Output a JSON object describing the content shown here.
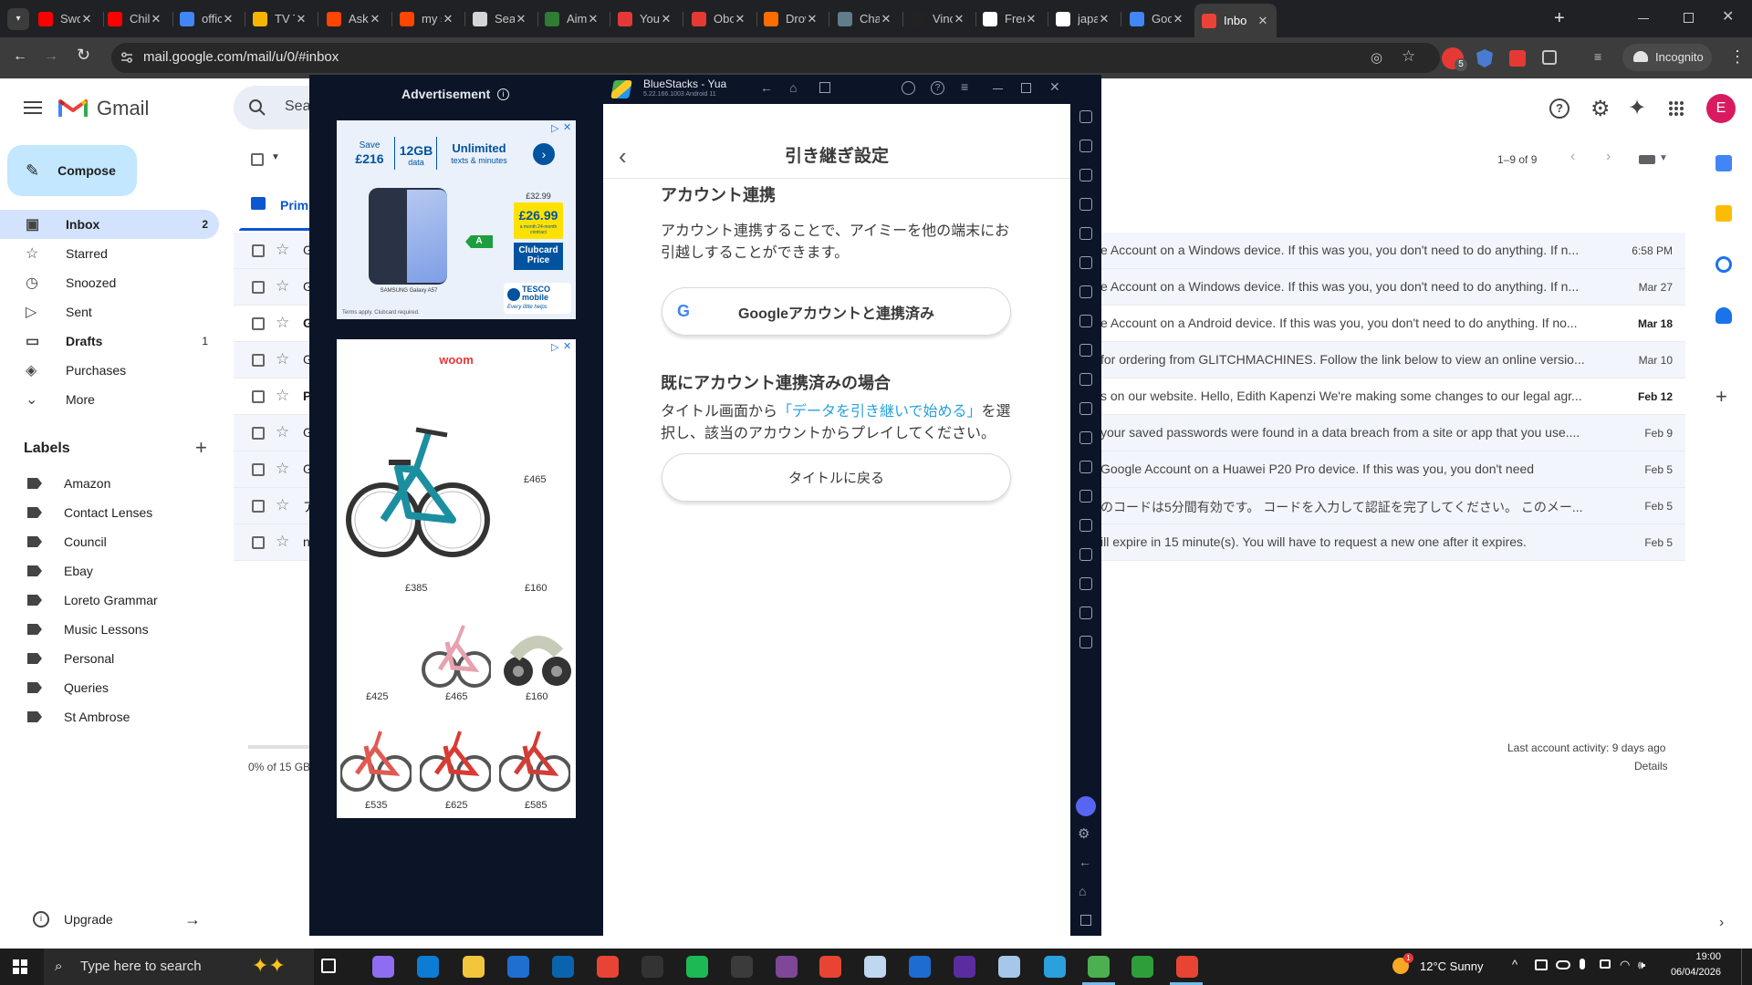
{
  "browser": {
    "tabs": [
      {
        "label": "Swor",
        "color": "#ff0000"
      },
      {
        "label": "Child",
        "color": "#ff0000"
      },
      {
        "label": "offici",
        "color": "#4285f4"
      },
      {
        "label": "TV Tr",
        "color": "#f4b400"
      },
      {
        "label": "AskM",
        "color": "#ff4500"
      },
      {
        "label": "my st",
        "color": "#ff4500"
      },
      {
        "label": "Searc",
        "color": "#d5d5d5"
      },
      {
        "label": "Aimy",
        "color": "#2e7d32"
      },
      {
        "label": "Youk",
        "color": "#e53935"
      },
      {
        "label": "Obor",
        "color": "#e53935"
      },
      {
        "label": "Drow",
        "color": "#ff6d00"
      },
      {
        "label": "Chap",
        "color": "#607d8b"
      },
      {
        "label": "Vinci",
        "color": "#222222"
      },
      {
        "label": "Free",
        "color": "#ffffff"
      },
      {
        "label": "japa",
        "color": "#ffffff"
      },
      {
        "label": "Goo",
        "color": "#4285f4"
      },
      {
        "label": "Inbo",
        "color": "#ea4335"
      }
    ],
    "url": "mail.google.com/mail/u/0/#inbox",
    "incognito_label": "Incognito",
    "extension_badge": "5"
  },
  "gmail": {
    "app_name": "Gmail",
    "search_placeholder": "Sea",
    "compose_label": "Compose",
    "nav": [
      {
        "label": "Inbox",
        "count": "2"
      },
      {
        "label": "Starred",
        "count": ""
      },
      {
        "label": "Snoozed",
        "count": ""
      },
      {
        "label": "Sent",
        "count": ""
      },
      {
        "label": "Drafts",
        "count": "1"
      },
      {
        "label": "Purchases",
        "count": ""
      },
      {
        "label": "More",
        "count": ""
      }
    ],
    "labels_heading": "Labels",
    "labels": [
      "Amazon",
      "Contact Lenses",
      "Council",
      "Ebay",
      "Loreto Grammar",
      "Music Lessons",
      "Personal",
      "Queries",
      "St Ambrose"
    ],
    "upgrade_label": "Upgrade",
    "tab_primary": "Prim",
    "pagination": "1–9 of 9",
    "avatar_letter": "E",
    "storage": "0% of 15 GB",
    "last_activity": "Last account activity: 9 days ago",
    "details": "Details",
    "emails": [
      {
        "sender": "G",
        "snippet": "e Account on a Windows device. If this was you, you don't need to do anything. If n...",
        "date": "6:58 PM",
        "unread": false
      },
      {
        "sender": "G",
        "snippet": "e Account on a Windows device. If this was you, you don't need to do anything. If n...",
        "date": "Mar 27",
        "unread": false
      },
      {
        "sender": "G",
        "snippet": "e Account on a Android device. If this was you, you don't need to do anything. If no...",
        "date": "Mar 18",
        "unread": true
      },
      {
        "sender": "G",
        "snippet": "for ordering from GLITCHMACHINES. Follow the link below to view an online versio...",
        "date": "Mar 10",
        "unread": false
      },
      {
        "sender": "P",
        "snippet": "s on our website. Hello, Edith Kapenzi We're making some changes to our legal agr...",
        "date": "Feb 12",
        "unread": true
      },
      {
        "sender": "G",
        "snippet": "your saved passwords were found in a data breach from a site or app that you use....",
        "date": "Feb 9",
        "unread": false
      },
      {
        "sender": "G",
        "snippet": "Google Account on a Huawei P20 Pro device. If this was you, you don't need",
        "date": "Feb 5",
        "unread": false
      },
      {
        "sender": "ア",
        "snippet": "のコードは5分間有効です。 コードを入力して認証を完了してください。 このメー...",
        "date": "Feb 5",
        "unread": false
      },
      {
        "sender": "n",
        "snippet": "ill expire in 15 minute(s). You will have to request a new one after it expires.",
        "date": "Feb 5",
        "unread": false
      }
    ]
  },
  "ad": {
    "heading": "Advertisement",
    "phone_ad": {
      "save_label": "Save",
      "save_amount": "£216",
      "data": "12GB",
      "data_sub": "data",
      "unlimited": "Unlimited",
      "unlimited_sub": "texts & minutes",
      "was_price": "£32.99",
      "price": "£26.99",
      "price_sub": "a month 24-month contract",
      "clubcard": "Clubcard Price",
      "phone_name": "SAMSUNG Galaxy A57",
      "energy": "A",
      "brand": "TESCO mobile",
      "brand_tag": "Every little helps",
      "terms": "Terms apply. Clubcard required."
    },
    "bike_ad": {
      "brand": "woom",
      "prices": [
        "£465",
        "£385",
        "£160",
        "£425",
        "£465",
        "£160",
        "£535",
        "£625",
        "£585"
      ]
    }
  },
  "bluestacks": {
    "title": "BlueStacks - Yua",
    "version": "5.22.166.1003  Android 11",
    "screen_title": "引き継ぎ設定",
    "section1_heading": "アカウント連携",
    "section1_text": "アカウント連携することで、アイミーを他の端末にお引越しすることができます。",
    "google_button": "Googleアカウントと連携済み",
    "section2_heading": "既にアカウント連携済みの場合",
    "section2_text_pre": "タイトル画面から",
    "section2_link": "「データを引き継いで始める」",
    "section2_text_post": "を選択し、該当のアカウントからプレイしてください。",
    "back_button": "タイトルに戻る"
  },
  "taskbar": {
    "search_placeholder": "Type here to search",
    "weather": "12°C  Sunny",
    "weather_badge": "1",
    "time": "19:00",
    "date": "06/04/2026"
  }
}
